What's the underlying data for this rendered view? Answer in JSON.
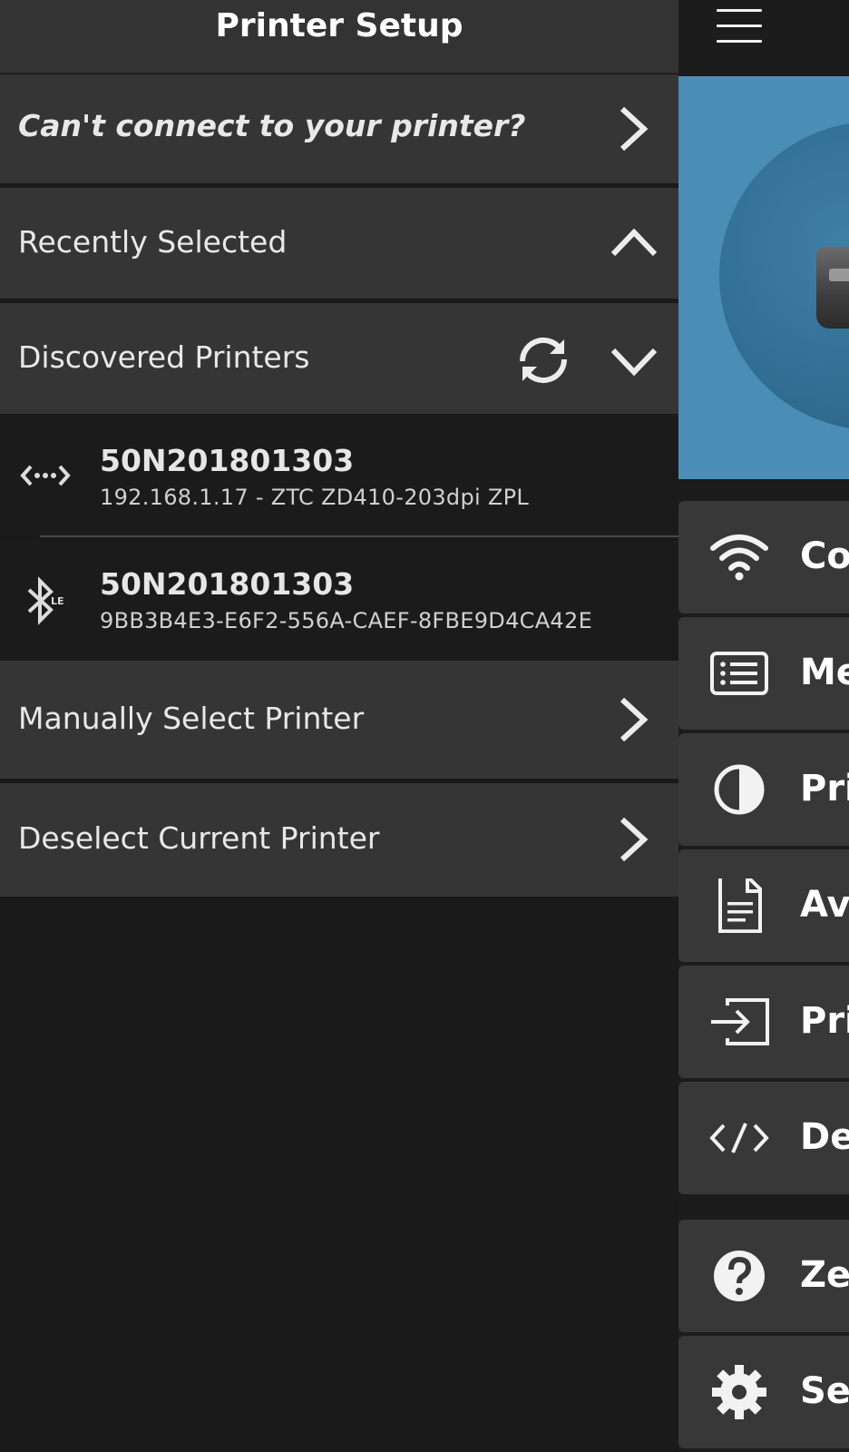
{
  "header": {
    "title": "Printer Setup",
    "menu_icon": "hamburger-menu-icon"
  },
  "help_row": {
    "label": "Can't connect to your printer?",
    "icon": "chevron-right-icon"
  },
  "recently_selected": {
    "label": "Recently Selected",
    "icon": "chevron-up-icon",
    "expanded": true
  },
  "discovered": {
    "label": "Discovered Printers",
    "refresh_icon": "refresh-icon",
    "toggle_icon": "chevron-down-icon",
    "printers": [
      {
        "name": "50N201801303",
        "detail": "192.168.1.17 - ZTC ZD410-203dpi ZPL",
        "connection": "network",
        "icon": "network-icon"
      },
      {
        "name": "50N201801303",
        "detail": "9BB3B4E3-E6F2-556A-CAEF-8FBE9D4CA42E",
        "connection": "bluetooth-le",
        "icon": "bluetooth-le-icon",
        "icon_badge": "LE"
      }
    ]
  },
  "actions": [
    {
      "label": "Manually Select Printer",
      "icon": "chevron-right-icon"
    },
    {
      "label": "Deselect Current Printer",
      "icon": "chevron-right-icon"
    }
  ],
  "background_menu": [
    {
      "label": "Co",
      "icon": "wifi-icon"
    },
    {
      "label": "Me",
      "icon": "list-icon"
    },
    {
      "label": "Pri",
      "icon": "contrast-icon"
    },
    {
      "label": "Ava",
      "icon": "document-icon"
    },
    {
      "label": "Pri",
      "icon": "print-to-icon"
    },
    {
      "label": "De",
      "icon": "code-icon"
    },
    {
      "label": "Ze",
      "icon": "help-icon"
    },
    {
      "label": "Se",
      "icon": "gear-icon"
    }
  ],
  "colors": {
    "background": "#1a1a1a",
    "row": "#353535",
    "header": "#333333",
    "hero": "#4a8eb5",
    "tile": "#383838",
    "text": "#e6e6e6"
  }
}
